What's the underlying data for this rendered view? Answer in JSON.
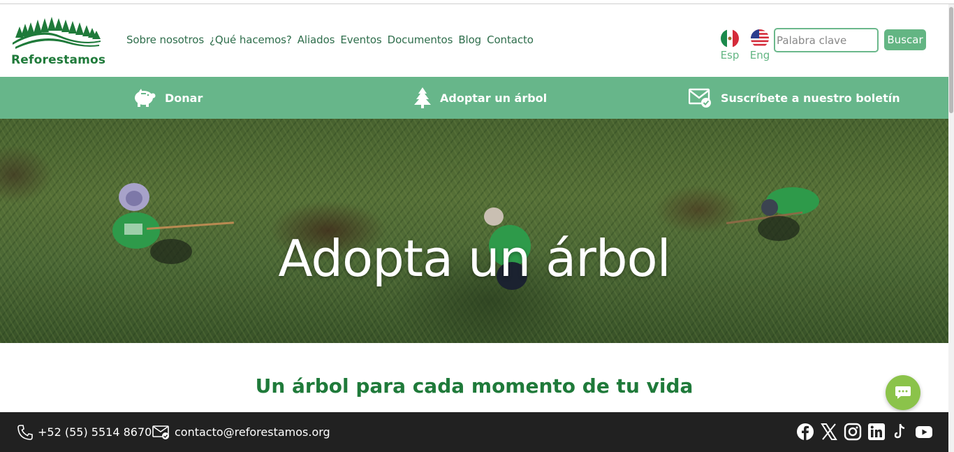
{
  "brand": {
    "name": "Reforestamos"
  },
  "nav": {
    "items": [
      {
        "label": "Sobre nosotros"
      },
      {
        "label": "¿Qué hacemos?"
      },
      {
        "label": "Aliados"
      },
      {
        "label": "Eventos"
      },
      {
        "label": "Documentos"
      },
      {
        "label": "Blog"
      },
      {
        "label": "Contacto"
      }
    ]
  },
  "languages": [
    {
      "label": "Esp",
      "icon": "mexico-flag-icon"
    },
    {
      "label": "Eng",
      "icon": "usa-flag-icon"
    }
  ],
  "search": {
    "placeholder": "Palabra clave",
    "value": "",
    "button_label": "Buscar"
  },
  "actions": [
    {
      "label": "Donar",
      "icon": "piggy-bank-icon"
    },
    {
      "label": "Adoptar un árbol",
      "icon": "tree-icon"
    },
    {
      "label": "Suscríbete a nuestro boletín",
      "icon": "mail-check-icon"
    }
  ],
  "hero": {
    "title": "Adopta un árbol"
  },
  "section": {
    "title": "Un árbol para cada momento de tu vida"
  },
  "contact": {
    "phone": "+52 (55) 5514 8670",
    "email": "contacto@reforestamos.org"
  },
  "socials": [
    "facebook-icon",
    "x-icon",
    "instagram-icon",
    "linkedin-icon",
    "tiktok-icon",
    "youtube-icon"
  ],
  "colors": {
    "brand_green": "#1f7a3a",
    "action_bar": "#67b68a",
    "accent": "#63b583",
    "footer": "#212121",
    "chat": "#8bc34a"
  }
}
